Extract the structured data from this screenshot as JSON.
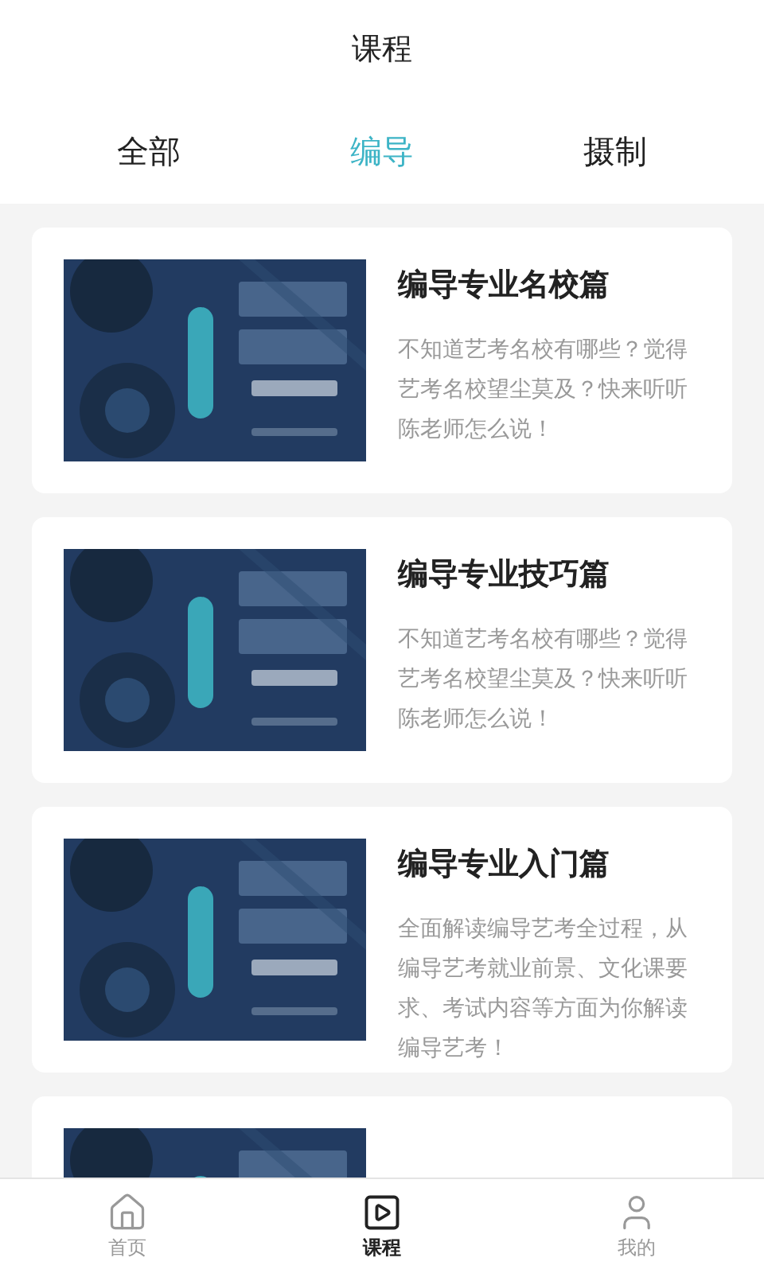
{
  "header": {
    "title": "课程"
  },
  "tabs": [
    {
      "label": "全部",
      "selected": false
    },
    {
      "label": "编导",
      "selected": true
    },
    {
      "label": "摄制",
      "selected": false
    }
  ],
  "courses": [
    {
      "cover": {
        "kind": "picture"
      },
      "title": "编导专业名校篇",
      "description": "不知道艺考名校有哪些？觉得艺考名校望尘莫及？快来听听陈老师怎么说！"
    },
    {
      "cover": {
        "kind": "picture"
      },
      "title": "编导专业技巧篇",
      "description": "不知道艺考名校有哪些？觉得艺考名校望尘莫及？快来听听陈老师怎么说！"
    },
    {
      "cover": {
        "kind": "picture"
      },
      "title": "编导专业入门篇",
      "description": "全面解读编导艺考全过程，从编导艺考就业前景、文化课要求、考试内容等方面为你解读编导艺考！"
    },
    {
      "cover": {
        "kind": "picture"
      }
    }
  ],
  "bottom_nav": [
    {
      "label": "首页",
      "kind": "home",
      "selected": false
    },
    {
      "label": "课程",
      "kind": "play",
      "selected": true
    },
    {
      "label": "我的",
      "kind": "user",
      "selected": false
    }
  ]
}
